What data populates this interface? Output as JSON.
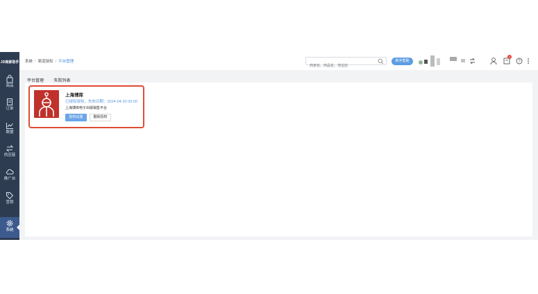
{
  "sidebar": {
    "logo": "JD商家助手",
    "items": [
      {
        "label": "商品",
        "icon": "bag-icon"
      },
      {
        "label": "订单",
        "icon": "document-icon"
      },
      {
        "label": "数据",
        "icon": "chart-icon"
      },
      {
        "label": "供应链",
        "icon": "swap-icon"
      },
      {
        "label": "推广台",
        "icon": "cloud-icon"
      },
      {
        "label": "营销",
        "icon": "tag-icon"
      },
      {
        "label": "系统",
        "icon": "gear-icon"
      }
    ]
  },
  "header": {
    "breadcrumb": [
      "系统",
      "渠道授权",
      "平台管理"
    ],
    "search_placeholder": "商家名、商品名、淘宝店",
    "new_button": "新手帮助",
    "badge_count": "1"
  },
  "tabs": [
    "平台管理",
    "失败列表"
  ],
  "card": {
    "title": "上海博库",
    "auth_status": "已授权授权，失效日期：2024-04-20 00:00",
    "description": "上海博库电子出版销售平台",
    "view_button": "授权设置",
    "revoke_button": "删除授权"
  },
  "colors": {
    "sidebar": "#2e3c52",
    "accent": "#5d9de3",
    "card_border": "#e04a33",
    "logo_bg": "#c0312b"
  }
}
